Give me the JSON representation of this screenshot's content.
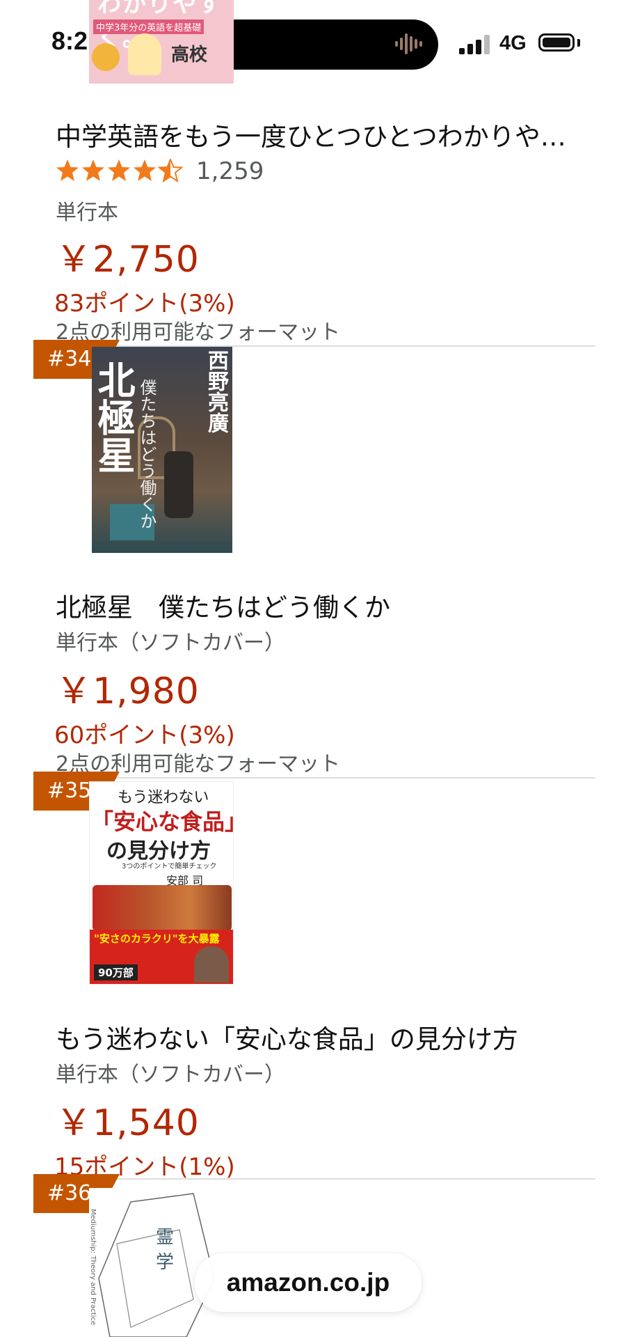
{
  "status_bar": {
    "time": "8:21",
    "network": "4G",
    "signal_bars_active": 3,
    "battery_level": 1.0
  },
  "items": [
    {
      "cover_banner_text": "中学3年分の英語を超基礎",
      "cover_tag": "高校",
      "title": "中学英語をもう一度ひとつひとつわかりや…",
      "rating": 4.5,
      "reviews": "1,259",
      "format": "単行本",
      "price": "￥2,750",
      "points": "83ポイント(3%)",
      "formats_available": "2点の利用可能なフォーマット"
    },
    {
      "rank": "#34",
      "cover_title": "北極星",
      "cover_author": "西野亮廣",
      "cover_subtitle": "僕たちはどう働くか",
      "title": "北極星　僕たちはどう働くか",
      "format": "単行本（ソフトカバー）",
      "price": "￥1,980",
      "points": "60ポイント(3%)",
      "formats_available": "2点の利用可能なフォーマット"
    },
    {
      "rank": "#35",
      "cover_top": "もう迷わない",
      "cover_main": "「安心な食品」",
      "cover_main2": "の見分け方",
      "cover_tagline": "3つのポイントで簡単チェック",
      "cover_author": "安部 司",
      "cover_band": "\"安さのカラクリ\"を大暴露",
      "cover_badge": "90万部",
      "title": "もう迷わない「安心な食品」の見分け方",
      "format": "単行本（ソフトカバー）",
      "price": "￥1,540",
      "points": "15ポイント(1%)"
    },
    {
      "rank": "#36",
      "cover_chars": [
        "霊",
        "学"
      ],
      "cover_side": "Mediumship: Theory and Practice"
    }
  ],
  "domain_label": "amazon.co.jp",
  "colors": {
    "price": "#B12704",
    "rank_badge": "#C45500",
    "star": "#F27A1A"
  }
}
